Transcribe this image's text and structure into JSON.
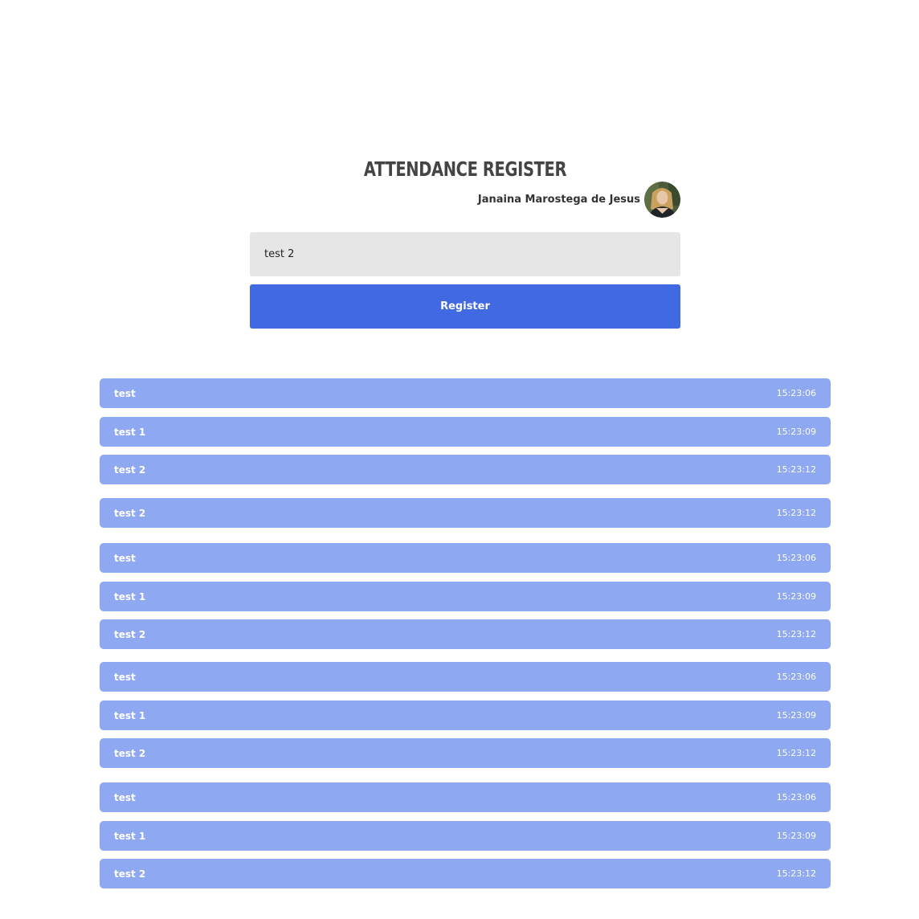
{
  "header": {
    "title": "Attendance Register",
    "user_name": "Janaina Marostega de Jesus"
  },
  "form": {
    "input_value": "test 2",
    "register_label": "Register"
  },
  "colors": {
    "accent": "#4169e1",
    "row_bg": "#8fa8f2",
    "input_bg": "#e6e6e6"
  },
  "entries": [
    {
      "label": "test",
      "time": "15:23:06"
    },
    {
      "label": "test 1",
      "time": "15:23:09"
    },
    {
      "label": "test 2",
      "time": "15:23:12"
    },
    {
      "label": "test 2",
      "time": "15:23:12"
    },
    {
      "label": "test",
      "time": "15:23:06"
    },
    {
      "label": "test 1",
      "time": "15:23:09"
    },
    {
      "label": "test 2",
      "time": "15:23:12"
    },
    {
      "label": "test",
      "time": "15:23:06"
    },
    {
      "label": "test 1",
      "time": "15:23:09"
    },
    {
      "label": "test 2",
      "time": "15:23:12"
    },
    {
      "label": "test",
      "time": "15:23:06"
    },
    {
      "label": "test 1",
      "time": "15:23:09"
    },
    {
      "label": "test 2",
      "time": "15:23:12"
    }
  ]
}
